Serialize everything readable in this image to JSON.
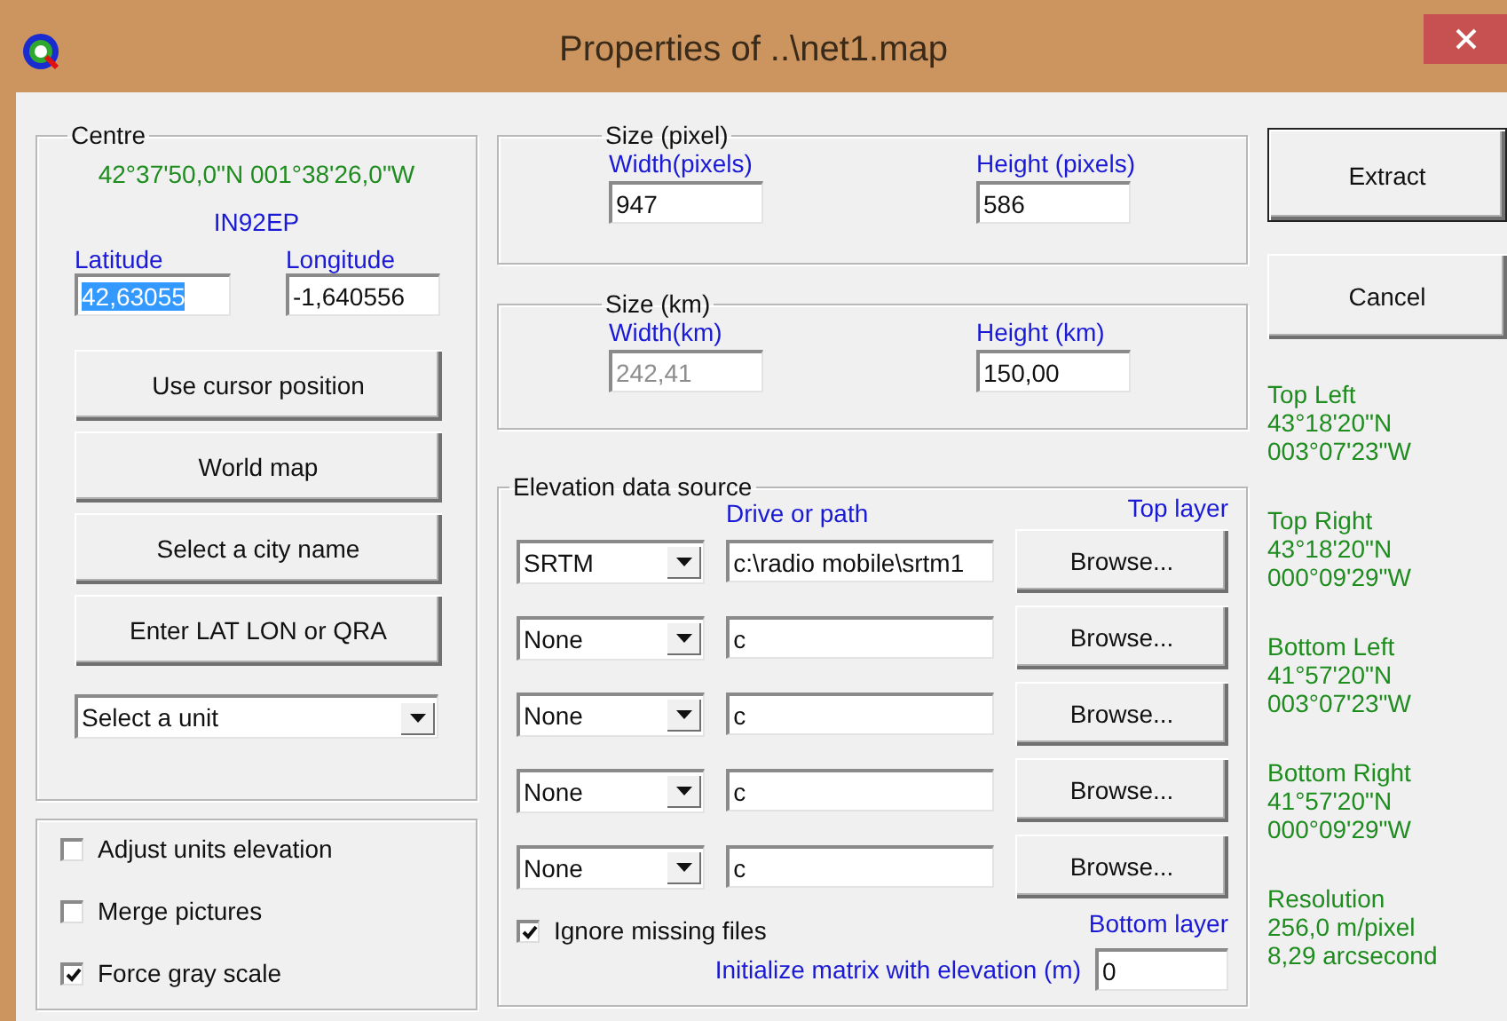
{
  "window": {
    "title": "Properties of ..\\net1.map"
  },
  "centre": {
    "legend": "Centre",
    "coordinates": "42°37'50,0\"N 001°38'26,0\"W",
    "locator": "IN92EP",
    "latitude": {
      "label": "Latitude",
      "value": "42,63055",
      "text_selected": true
    },
    "longitude": {
      "label": "Longitude",
      "value": "-1,640556",
      "text_selected": false
    },
    "buttons": [
      "Use cursor position",
      "World map",
      "Select a city name",
      "Enter LAT LON or QRA"
    ],
    "unit_select": {
      "value": "Select a unit"
    }
  },
  "options": [
    {
      "label": "Adjust units elevation",
      "checked": false
    },
    {
      "label": "Merge pictures",
      "checked": false
    },
    {
      "label": "Force gray scale",
      "checked": true
    }
  ],
  "size_pixel": {
    "legend": "Size (pixel)",
    "fields": [
      {
        "label": "Width(pixels)",
        "value": "947",
        "disabled": false
      },
      {
        "label": "Height (pixels)",
        "value": "586",
        "disabled": false
      }
    ]
  },
  "size_km": {
    "legend": "Size (km)",
    "fields": [
      {
        "label": "Width(km)",
        "value": "242,41",
        "disabled": true
      },
      {
        "label": "Height (km)",
        "value": "150,00",
        "disabled": false
      }
    ]
  },
  "elevation": {
    "legend": "Elevation data source",
    "path_heading": "Drive or path",
    "top_label": "Top layer",
    "bottom_label": "Bottom layer",
    "rows": [
      {
        "source": "SRTM",
        "path": "c:\\radio mobile\\srtm1",
        "button": "Browse..."
      },
      {
        "source": "None",
        "path": "c",
        "button": "Browse..."
      },
      {
        "source": "None",
        "path": "c",
        "button": "Browse..."
      },
      {
        "source": "None",
        "path": "c",
        "button": "Browse..."
      },
      {
        "source": "None",
        "path": "c",
        "button": "Browse..."
      }
    ],
    "ignore_missing": {
      "label": "Ignore missing files",
      "checked": true
    },
    "init": {
      "label": "Initialize matrix with elevation (m)",
      "value": "0"
    }
  },
  "actions": [
    {
      "label": "Extract",
      "default": true
    },
    {
      "label": "Cancel",
      "default": false
    }
  ],
  "info": [
    {
      "lines": [
        "Top Left",
        "43°18'20\"N",
        "003°07'23\"W"
      ]
    },
    {
      "lines": [
        "Top Right",
        "43°18'20\"N",
        "000°09'29\"W"
      ]
    },
    {
      "lines": [
        "Bottom Left",
        "41°57'20\"N",
        "003°07'23\"W"
      ]
    },
    {
      "lines": [
        "Bottom Right",
        "41°57'20\"N",
        "000°09'29\"W"
      ]
    },
    {
      "lines": [
        "Resolution",
        "256,0 m/pixel",
        "8,29 arcsecond"
      ]
    }
  ]
}
